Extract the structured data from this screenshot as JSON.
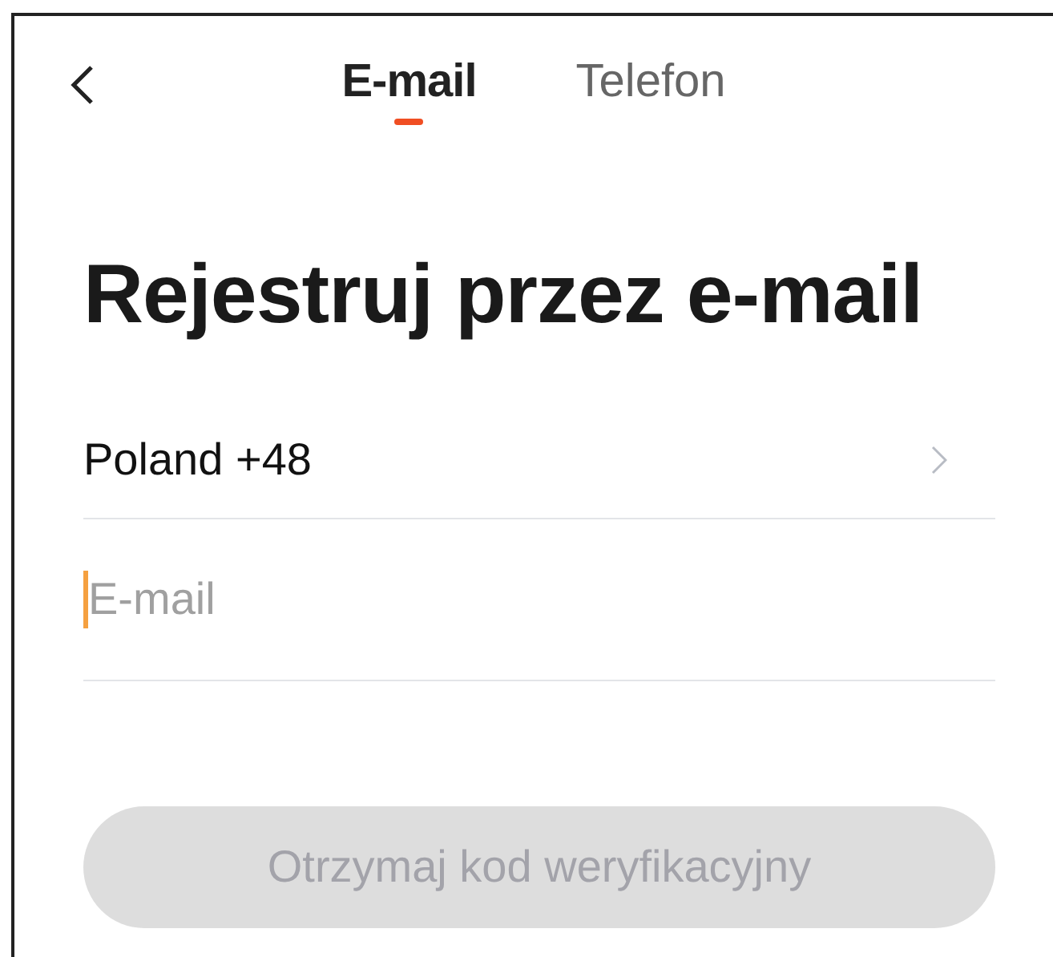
{
  "tabs": [
    {
      "label": "E-mail",
      "selected": true
    },
    {
      "label": "Telefon",
      "selected": false
    }
  ],
  "title": "Rejestruj przez e-mail",
  "country": {
    "label": "Poland +48"
  },
  "email_field": {
    "placeholder": "E-mail",
    "focused": true
  },
  "submit_button": {
    "label": "Otrzymaj kod weryfikacyjny",
    "disabled": true
  }
}
